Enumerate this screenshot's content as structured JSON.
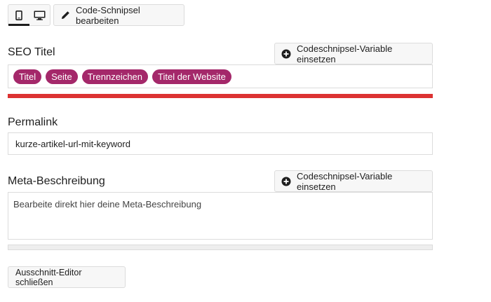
{
  "toolbar": {
    "preview_modes": [
      {
        "icon": "mobile-icon",
        "active": true
      },
      {
        "icon": "desktop-icon",
        "active": false
      }
    ],
    "edit_snippet_label": "Code-Schnipsel bearbeiten",
    "edit_icon": "pencil-icon"
  },
  "seo_title": {
    "label": "SEO Titel",
    "insert_variable_label": "Codeschnipsel-Variable einsetzen",
    "insert_icon": "plus-circle-icon",
    "tokens": [
      "Titel",
      "Seite",
      "Trennzeichen",
      "Titel der Website"
    ],
    "progress_color": "#dc3232"
  },
  "permalink": {
    "label": "Permalink",
    "value": "kurze-artikel-url-mit-keyword"
  },
  "meta_description": {
    "label": "Meta-Beschreibung",
    "insert_variable_label": "Codeschnipsel-Variable einsetzen",
    "insert_icon": "plus-circle-icon",
    "placeholder": "Bearbeite direkt hier deine Meta-Beschreibung"
  },
  "footer": {
    "close_editor_label": "Ausschnitt-Editor schließen"
  },
  "colors": {
    "token_bg": "#a4286a",
    "seo_bar": "#dc3232"
  }
}
